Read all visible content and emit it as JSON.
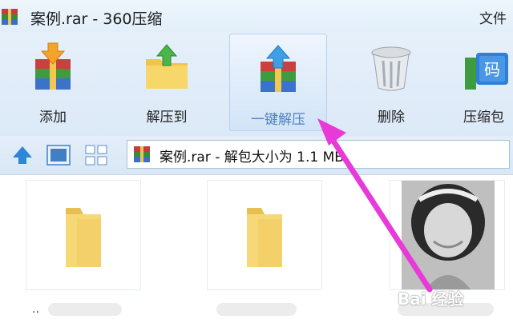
{
  "window": {
    "title": "案例.rar - 360压缩",
    "menu_file": "文件"
  },
  "toolbar": {
    "buttons": [
      {
        "label": "添加",
        "icon": "add-archive-icon"
      },
      {
        "label": "解压到",
        "icon": "extract-to-folder-icon"
      },
      {
        "label": "一键解压",
        "icon": "one-click-extract-icon",
        "active": true
      },
      {
        "label": "删除",
        "icon": "delete-bin-icon"
      },
      {
        "label": "压缩包",
        "icon": "archive-code-icon"
      }
    ]
  },
  "nav": {
    "address": "案例.rar - 解包大小为 1.1 MB"
  },
  "files": {
    "parent_dots": ".."
  },
  "watermark": {
    "text": "Bai  经验"
  },
  "colors": {
    "accent": "#4e82bd",
    "annotation_arrow": "#e83ad8",
    "folder": "#f3d46a"
  }
}
